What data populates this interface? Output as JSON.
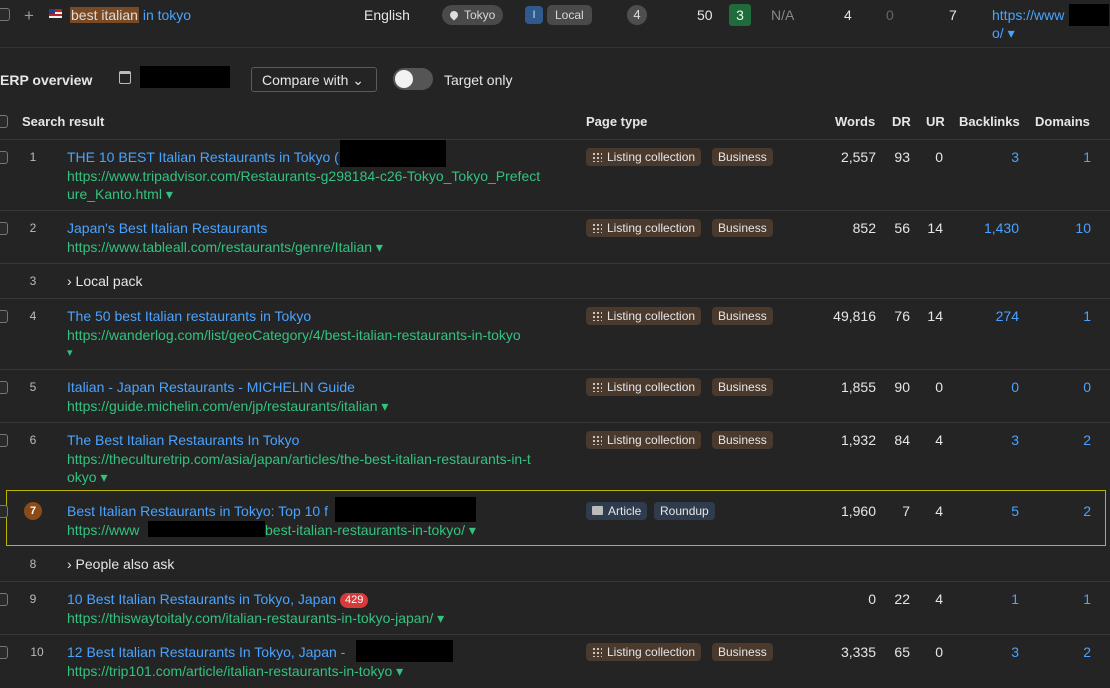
{
  "top": {
    "keyword_highlight": "best italian",
    "keyword_rest": " in tokyo",
    "language": "English",
    "location": "Tokyo",
    "i_label": "I",
    "local_label": "Local",
    "circle_num": "4",
    "num50": "50",
    "green_num": "3",
    "na": "N/A",
    "num4": "4",
    "num0": "0",
    "num7": "7",
    "url_line1": "https://www",
    "url_line2": "o/ ▾"
  },
  "toolbar": {
    "title": "ERP overview",
    "compare": "Compare with ⌄",
    "target": "Target only"
  },
  "headers": {
    "search_result": "Search result",
    "page_type": "Page type",
    "words": "Words",
    "dr": "DR",
    "ur": "UR",
    "backlinks": "Backlinks",
    "domains": "Domains"
  },
  "rows": [
    {
      "n": "1",
      "title": "THE 10 BEST Italian Restaurants in Tokyo (",
      "url1": "https://www.tripadvisor.com/Restaurants-g298184-c26-Tokyo_Tokyo_Prefect",
      "url2": "ure_Kanto.html ▾",
      "t1": "Listing collection",
      "t2": "Business",
      "words": "2,557",
      "dr": "93",
      "ur": "0",
      "bl": "3",
      "dm": "1"
    },
    {
      "n": "2",
      "title": "Japan's Best Italian Restaurants",
      "url1": "https://www.tableall.com/restaurants/genre/Italian ▾",
      "t1": "Listing collection",
      "t2": "Business",
      "words": "852",
      "dr": "56",
      "ur": "14",
      "bl": "1,430",
      "dm": "10"
    },
    {
      "n": "3",
      "label": "› Local pack"
    },
    {
      "n": "4",
      "title": "The 50 best Italian restaurants in Tokyo",
      "url1": "https://wanderlog.com/list/geoCategory/4/best-italian-restaurants-in-tokyo",
      "url2": "▾",
      "t1": "Listing collection",
      "t2": "Business",
      "words": "49,816",
      "dr": "76",
      "ur": "14",
      "bl": "274",
      "dm": "1"
    },
    {
      "n": "5",
      "title": "Italian - Japan Restaurants - MICHELIN Guide",
      "url1": "https://guide.michelin.com/en/jp/restaurants/italian ▾",
      "t1": "Listing collection",
      "t2": "Business",
      "words": "1,855",
      "dr": "90",
      "ur": "0",
      "bl": "0",
      "dm": "0"
    },
    {
      "n": "6",
      "title": "The Best Italian Restaurants In Tokyo",
      "url1": "https://theculturetrip.com/asia/japan/articles/the-best-italian-restaurants-in-t",
      "url2": "okyo ▾",
      "t1": "Listing collection",
      "t2": "Business",
      "words": "1,932",
      "dr": "84",
      "ur": "4",
      "bl": "3",
      "dm": "2"
    },
    {
      "n": "7",
      "title": "Best Italian Restaurants in Tokyo: Top 10 f",
      "url1a": "https://www",
      "url1b": "best-italian-restaurants-in-tokyo/ ▾",
      "t1": "Article",
      "t2": "Roundup",
      "words": "1,960",
      "dr": "7",
      "ur": "4",
      "bl": "5",
      "dm": "2"
    },
    {
      "n": "8",
      "label": "› People also ask"
    },
    {
      "n": "9",
      "title": "10 Best Italian Restaurants in Tokyo, Japan",
      "err": "429",
      "url1": "https://thiswaytoitaly.com/italian-restaurants-in-tokyo-japan/ ▾",
      "words": "0",
      "dr": "22",
      "ur": "4",
      "bl": "1",
      "dm": "1"
    },
    {
      "n": "10",
      "title": "12 Best Italian Restaurants In Tokyo, Japan -",
      "url1": "https://trip101.com/article/italian-restaurants-in-tokyo ▾",
      "t1": "Listing collection",
      "t2": "Business",
      "words": "3,335",
      "dr": "65",
      "ur": "0",
      "bl": "3",
      "dm": "2"
    }
  ]
}
